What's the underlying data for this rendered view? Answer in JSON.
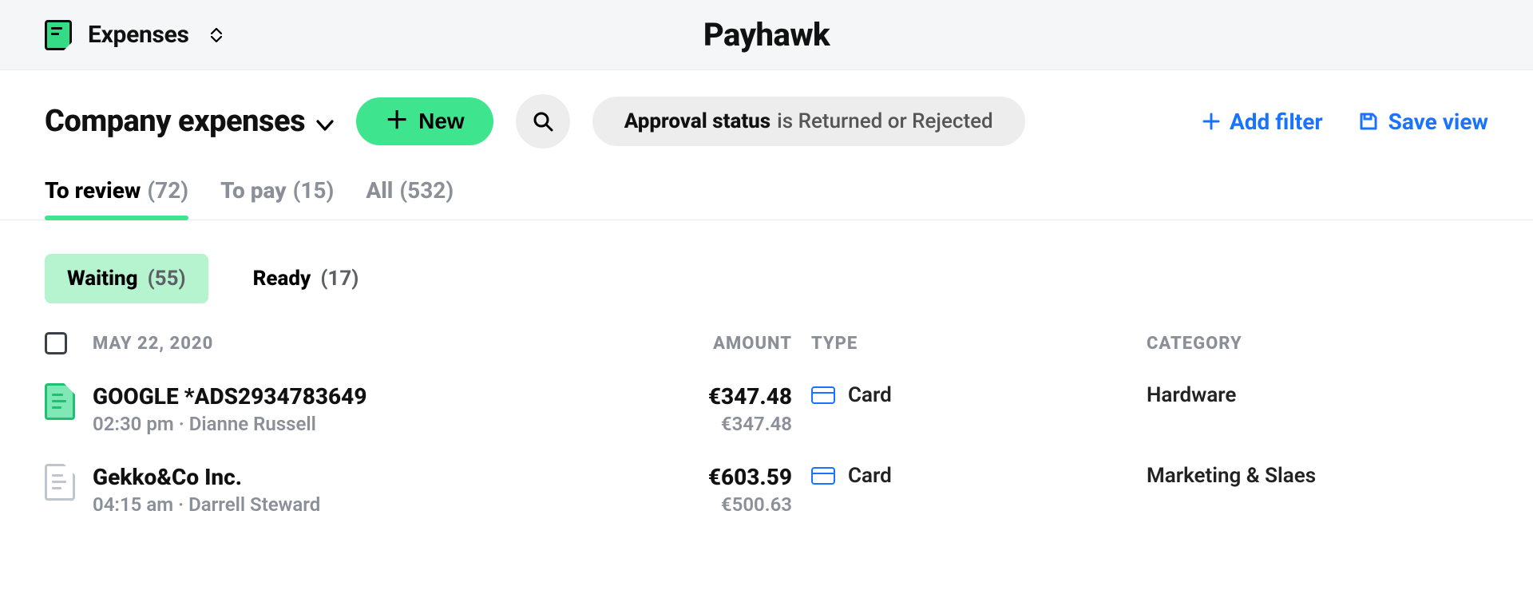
{
  "appbar": {
    "title": "Expenses",
    "brand": "Payhawk"
  },
  "header": {
    "page_title": "Company expenses",
    "new_label": "New",
    "filter_field": "Approval status",
    "filter_rest": "is Returned or Rejected",
    "add_filter": "Add filter",
    "save_view": "Save view"
  },
  "tabs": [
    {
      "label": "To review",
      "count": "(72)",
      "active": true
    },
    {
      "label": "To pay",
      "count": "(15)",
      "active": false
    },
    {
      "label": "All",
      "count": "(532)",
      "active": false
    }
  ],
  "subtabs": [
    {
      "label": "Waiting",
      "count": "(55)",
      "active": true
    },
    {
      "label": "Ready",
      "count": "(17)",
      "active": false
    }
  ],
  "table": {
    "date_header": "MAY 22, 2020",
    "columns": {
      "amount": "AMOUNT",
      "type": "TYPE",
      "category": "CATEGORY"
    },
    "rows": [
      {
        "icon_green": true,
        "merchant": "GOOGLE *ADS2934783649",
        "time": "02:30 pm",
        "person": "Dianne Russell",
        "amount": "€347.48",
        "amount_sub": "€347.48",
        "type": "Card",
        "category": "Hardware"
      },
      {
        "icon_green": false,
        "merchant": "Gekko&Co Inc.",
        "time": "04:15 am",
        "person": "Darrell Steward",
        "amount": "€603.59",
        "amount_sub": "€500.63",
        "type": "Card",
        "category": "Marketing & Slaes"
      }
    ]
  }
}
